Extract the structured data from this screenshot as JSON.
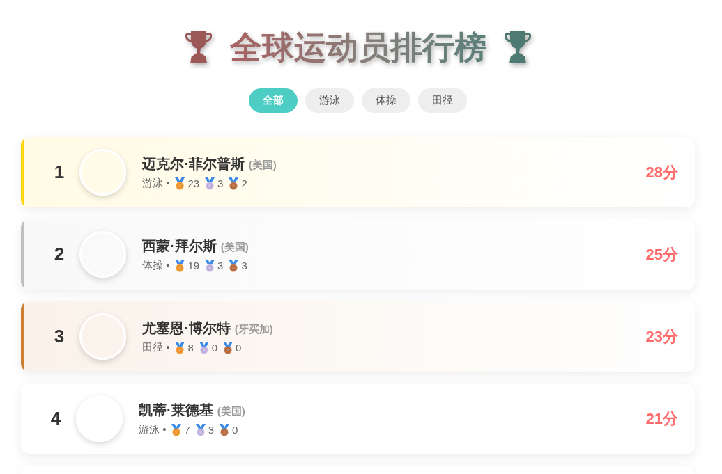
{
  "header": {
    "title": "全球运动员排行榜"
  },
  "filters": [
    {
      "label": "全部",
      "selected": true
    },
    {
      "label": "游泳",
      "selected": false
    },
    {
      "label": "体操",
      "selected": false
    },
    {
      "label": "田径",
      "selected": false
    }
  ],
  "athletes": [
    {
      "rank": "1",
      "name": "迈克尔·菲尔普斯",
      "country": "(美国)",
      "sport": "游泳 •",
      "color": "#ffd700",
      "medals": [
        {
          "kind": "gold",
          "count": "23"
        },
        {
          "kind": "silver",
          "count": "3"
        },
        {
          "kind": "bronze",
          "count": "2"
        }
      ],
      "score": "28分"
    },
    {
      "rank": "2",
      "name": "西蒙·拜尔斯",
      "country": "(美国)",
      "sport": "体操 •",
      "color": "#c0c0c0",
      "medals": [
        {
          "kind": "gold",
          "count": "19"
        },
        {
          "kind": "silver",
          "count": "3"
        },
        {
          "kind": "bronze",
          "count": "3"
        }
      ],
      "score": "25分"
    },
    {
      "rank": "3",
      "name": "尤塞恩·博尔特",
      "country": "(牙买加)",
      "sport": "田径 •",
      "color": "#cd7f32",
      "medals": [
        {
          "kind": "gold",
          "count": "8"
        },
        {
          "kind": "silver",
          "count": "0"
        },
        {
          "kind": "bronze",
          "count": "0"
        }
      ],
      "score": "23分"
    },
    {
      "rank": "4",
      "name": "凯蒂·莱德基",
      "country": "(美国)",
      "sport": "游泳 •",
      "medals": [
        {
          "kind": "gold",
          "count": "7"
        },
        {
          "kind": "silver",
          "count": "3"
        },
        {
          "kind": "bronze",
          "count": "0"
        }
      ],
      "score": "21分"
    }
  ],
  "more_below": true
}
